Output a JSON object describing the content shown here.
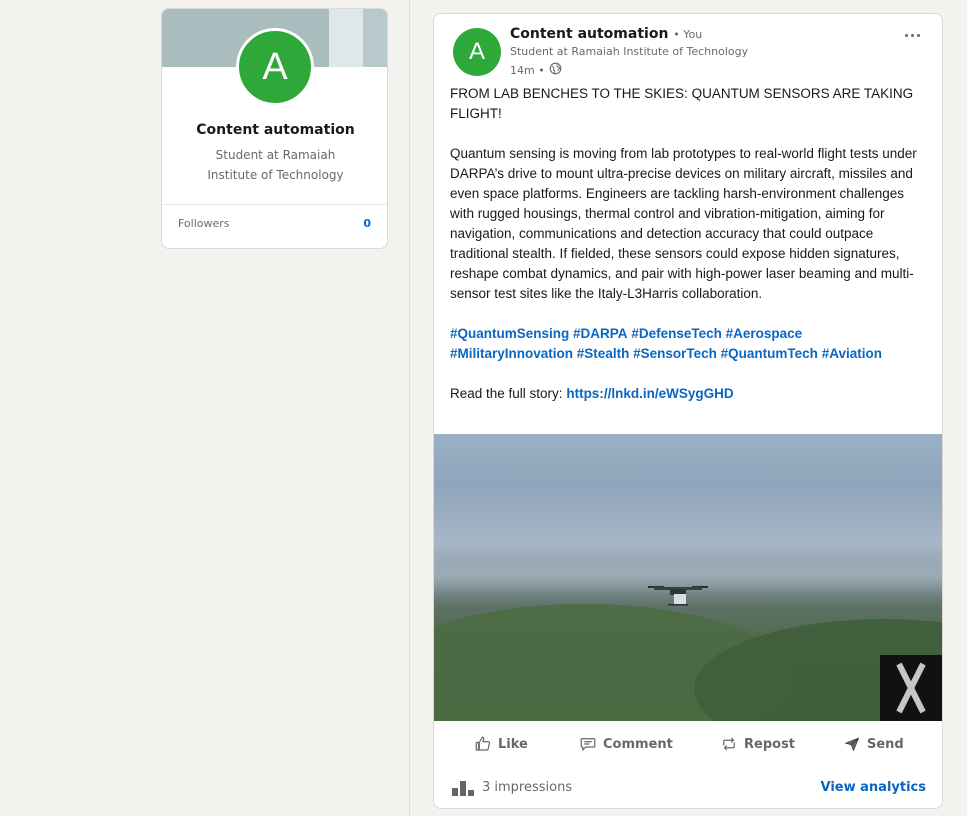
{
  "profile": {
    "avatar_letter": "A",
    "name": "Content automation",
    "headline": "Student at Ramaiah Institute of Technology",
    "followers_label": "Followers",
    "followers_count": "0"
  },
  "post": {
    "author_avatar_letter": "A",
    "author_name": "Content automation",
    "author_badge": "• You",
    "author_headline": "Student at Ramaiah Institute of Technology",
    "time": "14m •",
    "visibility_icon": "globe-icon",
    "title": "FROM LAB BENCHES TO THE SKIES: QUANTUM SENSORS ARE TAKING FLIGHT!",
    "body": "Quantum sensing is moving from lab prototypes to real-world flight tests under DARPA’s drive to mount ultra-precise devices on military aircraft, missiles and even space platforms. Engineers are tackling harsh-environment challenges with rugged housings, thermal control and vibration-mitigation, aiming for navigation, communications and detection accuracy that could outpace traditional stealth. If fielded, these sensors could expose hidden signatures, reshape combat dynamics, and pair with high-power laser beaming and multi-sensor test sites like the Italy-L3Harris collaboration.",
    "hashtags": [
      "#QuantumSensing",
      "#DARPA",
      "#DefenseTech",
      "#Aerospace",
      "#MilitaryInnovation",
      "#Stealth",
      "#SensorTech",
      "#QuantumTech",
      "#Aviation"
    ],
    "read_more_label": "Read the full story:",
    "link": "https://lnkd.in/eWSygGHD",
    "actions": {
      "like": "Like",
      "comment": "Comment",
      "repost": "Repost",
      "send": "Send"
    },
    "impressions": "3 impressions",
    "view_analytics": "View analytics"
  },
  "colors": {
    "avatar_green": "#2fa83a",
    "link_blue": "#0a66c2"
  }
}
